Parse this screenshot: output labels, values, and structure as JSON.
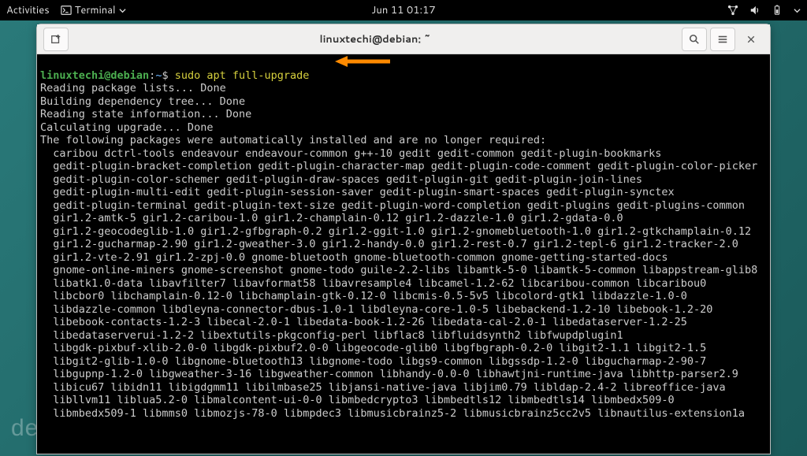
{
  "topbar": {
    "activities": "Activities",
    "terminal_label": "Terminal",
    "datetime": "Jun 11  01:17"
  },
  "window": {
    "title": "linuxtechi@debian: ~"
  },
  "terminal": {
    "prompt_userhost": "linuxtechi@debian",
    "prompt_sep": ":",
    "prompt_path": "~",
    "prompt_symbol": "$",
    "command": "sudo apt full-upgrade",
    "output_lines": [
      "Reading package lists... Done",
      "Building dependency tree... Done",
      "Reading state information... Done",
      "Calculating upgrade... Done",
      "The following packages were automatically installed and are no longer required:",
      "  caribou dctrl-tools endeavour endeavour-common g++-10 gedit gedit-common gedit-plugin-bookmarks",
      "  gedit-plugin-bracket-completion gedit-plugin-character-map gedit-plugin-code-comment gedit-plugin-color-picker",
      "  gedit-plugin-color-schemer gedit-plugin-draw-spaces gedit-plugin-git gedit-plugin-join-lines",
      "  gedit-plugin-multi-edit gedit-plugin-session-saver gedit-plugin-smart-spaces gedit-plugin-synctex",
      "  gedit-plugin-terminal gedit-plugin-text-size gedit-plugin-word-completion gedit-plugins gedit-plugins-common",
      "  gir1.2-amtk-5 gir1.2-caribou-1.0 gir1.2-champlain-0.12 gir1.2-dazzle-1.0 gir1.2-gdata-0.0",
      "  gir1.2-geocodeglib-1.0 gir1.2-gfbgraph-0.2 gir1.2-ggit-1.0 gir1.2-gnomebluetooth-1.0 gir1.2-gtkchamplain-0.12",
      "  gir1.2-gucharmap-2.90 gir1.2-gweather-3.0 gir1.2-handy-0.0 gir1.2-rest-0.7 gir1.2-tepl-6 gir1.2-tracker-2.0",
      "  gir1.2-vte-2.91 gir1.2-zpj-0.0 gnome-bluetooth gnome-bluetooth-common gnome-getting-started-docs",
      "  gnome-online-miners gnome-screenshot gnome-todo guile-2.2-libs libamtk-5-0 libamtk-5-common libappstream-glib8",
      "  libatk1.0-data libavfilter7 libavformat58 libavresample4 libcamel-1.2-62 libcaribou-common libcaribou0",
      "  libcbor0 libchamplain-0.12-0 libchamplain-gtk-0.12-0 libcmis-0.5-5v5 libcolord-gtk1 libdazzle-1.0-0",
      "  libdazzle-common libdleyna-connector-dbus-1.0-1 libdleyna-core-1.0-5 libebackend-1.2-10 libebook-1.2-20",
      "  libebook-contacts-1.2-3 libecal-2.0-1 libedata-book-1.2-26 libedata-cal-2.0-1 libedataserver-1.2-25",
      "  libedataserverui-1.2-2 libextutils-pkgconfig-perl libflac8 libfluidsynth2 libfwupdplugin1",
      "  libgdk-pixbuf-xlib-2.0-0 libgdk-pixbuf2.0-0 libgeocode-glib0 libgfbgraph-0.2-0 libgit2-1.1 libgit2-1.5",
      "  libgit2-glib-1.0-0 libgnome-bluetooth13 libgnome-todo libgs9-common libgssdp-1.2-0 libgucharmap-2-90-7",
      "  libgupnp-1.2-0 libgweather-3-16 libgweather-common libhandy-0.0-0 libhawtjni-runtime-java libhttp-parser2.9",
      "  libicu67 libidn11 libigdgmm11 libilmbase25 libjansi-native-java libjim0.79 libldap-2.4-2 libreoffice-java",
      "  libllvm11 liblua5.2-0 libmalcontent-ui-0-0 libmbedcrypto3 libmbedtls12 libmbedtls14 libmbedx509-0",
      "  libmbedx509-1 libmms0 libmozjs-78-0 libmpdec3 libmusicbrainz5-2 libmusicbrainz5cc2v5 libnautilus-extension1a"
    ]
  },
  "desktop": {
    "logo_text": "debian"
  }
}
